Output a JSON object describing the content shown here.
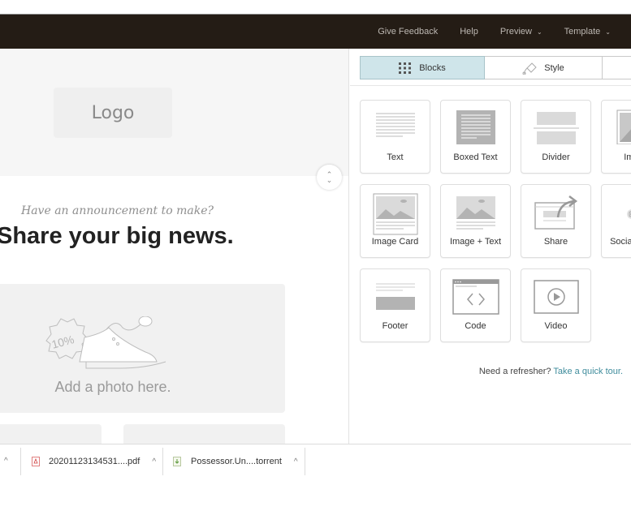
{
  "topnav": {
    "items": [
      {
        "label": "Give Feedback",
        "has_dropdown": false
      },
      {
        "label": "Help",
        "has_dropdown": false
      },
      {
        "label": "Preview",
        "has_dropdown": true
      },
      {
        "label": "Template",
        "has_dropdown": true
      }
    ],
    "dropdown_glyph": "⌄"
  },
  "canvas": {
    "logo_label": "Logo",
    "subtitle": "Have an announcement to make?",
    "headline": "Share your big news.",
    "photo_placeholder": "Add a photo here.",
    "photo_badge": "10%",
    "scroll_handle_glyphs": [
      "⌃",
      "⌄"
    ]
  },
  "sidebar": {
    "tabs": [
      {
        "label": "Blocks",
        "icon": "grid-icon",
        "active": true
      },
      {
        "label": "Style",
        "icon": "paint-bucket-icon",
        "active": false
      },
      {
        "label": "",
        "icon": "",
        "active": false
      }
    ],
    "blocks": [
      {
        "label": "Text",
        "icon": "text-block-icon"
      },
      {
        "label": "Boxed Text",
        "icon": "boxed-text-icon"
      },
      {
        "label": "Divider",
        "icon": "divider-icon"
      },
      {
        "label": "Image",
        "icon": "image-icon"
      },
      {
        "label": "Image Card",
        "icon": "image-card-icon"
      },
      {
        "label": "Image + Text",
        "icon": "image-text-icon"
      },
      {
        "label": "Share",
        "icon": "share-icon"
      },
      {
        "label": "Social Follow",
        "icon": "social-follow-icon"
      },
      {
        "label": "Footer",
        "icon": "footer-icon"
      },
      {
        "label": "Code",
        "icon": "code-icon"
      },
      {
        "label": "Video",
        "icon": "video-icon"
      }
    ],
    "refresher_text": "Need a refresher?",
    "refresher_link": "Take a quick tour."
  },
  "downloads": {
    "items": [
      {
        "name": "20201123134531....pdf",
        "icon": "pdf-file-icon"
      },
      {
        "name": "Possessor.Un....torrent",
        "icon": "torrent-file-icon"
      }
    ],
    "caret": "^"
  },
  "colors": {
    "topbar": "#241c15",
    "active_tab": "#cfe5ea",
    "link": "#3f8c9c"
  }
}
